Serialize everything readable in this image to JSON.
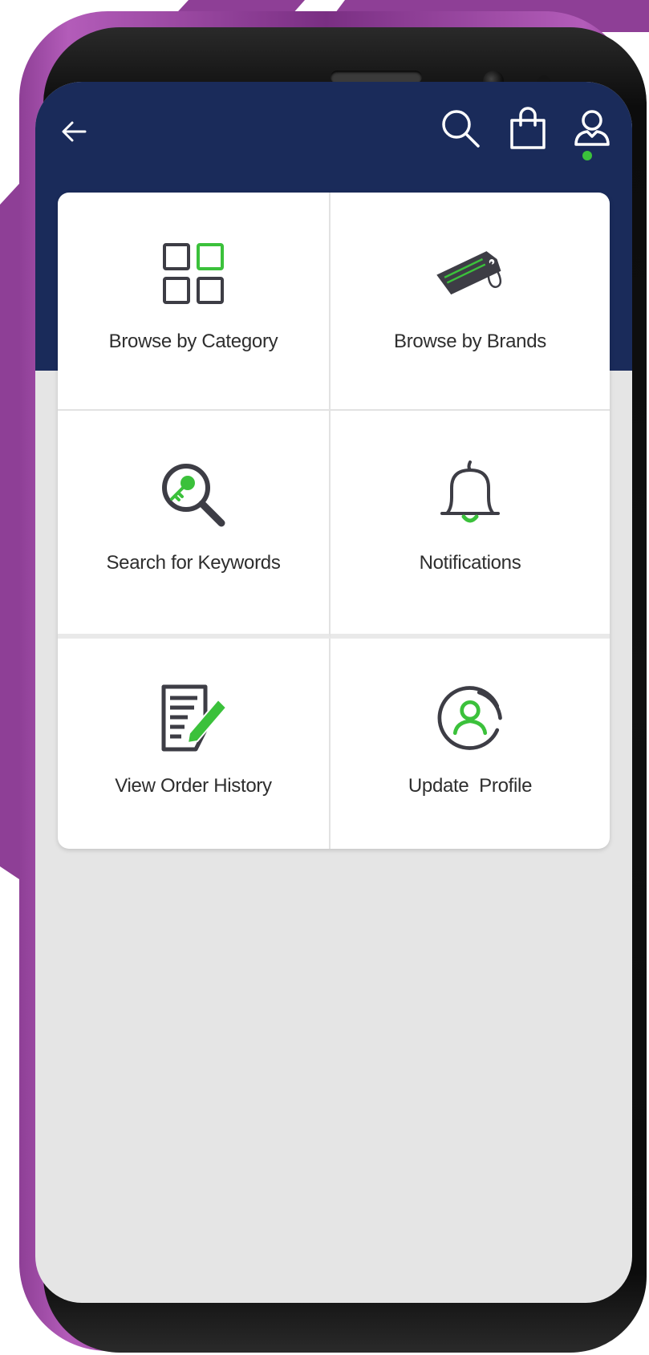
{
  "colors": {
    "header_bg": "#1a2b5a",
    "accent_green": "#3bc13b",
    "icon_gray": "#3d3d45",
    "screen_bg": "#e5e5e5",
    "phone_purple": "#8e3f96"
  },
  "header": {
    "back_icon": "arrow-left-icon",
    "actions": [
      {
        "name": "search",
        "icon": "search-icon"
      },
      {
        "name": "bag",
        "icon": "shopping-bag-icon"
      },
      {
        "name": "profile",
        "icon": "user-icon"
      }
    ]
  },
  "menu": {
    "items": [
      {
        "label": "Browse by Category",
        "icon": "grid-icon"
      },
      {
        "label": "Browse by Brands",
        "icon": "tag-icon"
      },
      {
        "label": "Search for Keywords",
        "icon": "key-search-icon"
      },
      {
        "label": "Notifications",
        "icon": "bell-icon"
      },
      {
        "label": "View Order History",
        "icon": "document-edit-icon"
      },
      {
        "label": "Update  Profile",
        "icon": "profile-circle-icon"
      }
    ]
  }
}
